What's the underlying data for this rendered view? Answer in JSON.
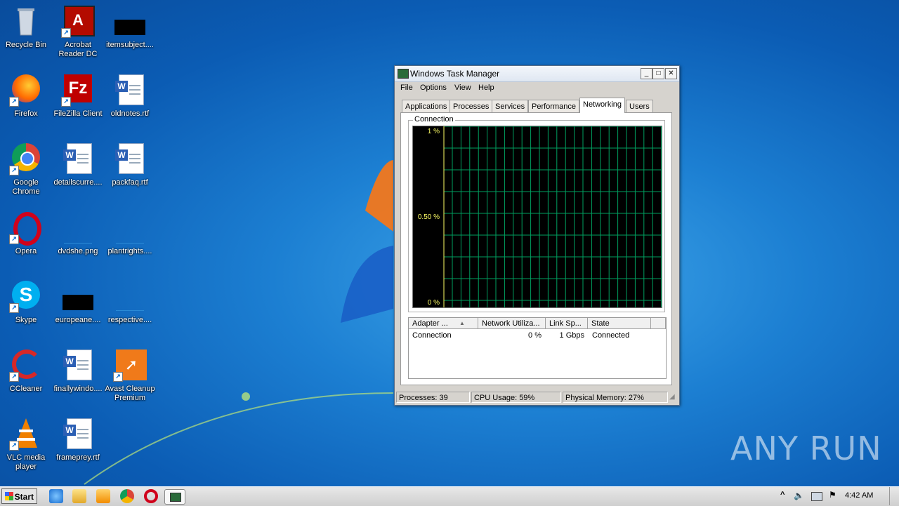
{
  "desktop": {
    "icons": [
      {
        "label": "Recycle Bin"
      },
      {
        "label": "Acrobat Reader DC"
      },
      {
        "label": "itemsubject...."
      },
      {
        "label": "Firefox"
      },
      {
        "label": "FileZilla Client"
      },
      {
        "label": "oldnotes.rtf"
      },
      {
        "label": "Google Chrome"
      },
      {
        "label": "detailscurre...."
      },
      {
        "label": "packfaq.rtf"
      },
      {
        "label": "Opera"
      },
      {
        "label": "dvdshe.png"
      },
      {
        "label": "plantrights...."
      },
      {
        "label": "Skype"
      },
      {
        "label": "europeane...."
      },
      {
        "label": "respective...."
      },
      {
        "label": "CCleaner"
      },
      {
        "label": "finallywindo...."
      },
      {
        "label": "Avast Cleanup Premium"
      },
      {
        "label": "VLC media player"
      },
      {
        "label": "frameprey.rtf"
      }
    ],
    "watermark": "ANY RUN"
  },
  "taskmgr": {
    "title": "Windows Task Manager",
    "menu": [
      "File",
      "Options",
      "View",
      "Help"
    ],
    "tabs": [
      "Applications",
      "Processes",
      "Services",
      "Performance",
      "Networking",
      "Users"
    ],
    "active_tab": "Networking",
    "group_label": "Connection",
    "graph": {
      "y_labels": [
        "1 %",
        "0.50 %",
        "0 %"
      ],
      "series_color": "#00a060"
    },
    "columns": [
      "Adapter ...",
      "Network Utiliza...",
      "Link Sp...",
      "State"
    ],
    "rows": [
      {
        "adapter": "Connection",
        "utilization": "0 %",
        "link_speed": "1 Gbps",
        "state": "Connected"
      }
    ],
    "status": {
      "processes": "Processes: 39",
      "cpu": "CPU Usage: 59%",
      "memory": "Physical Memory: 27%"
    },
    "buttons": {
      "minimize": "_",
      "maximize": "□",
      "close": "✕"
    }
  },
  "taskbar": {
    "start_label": "Start",
    "clock": "4:42 AM",
    "tray_expand": "^"
  }
}
